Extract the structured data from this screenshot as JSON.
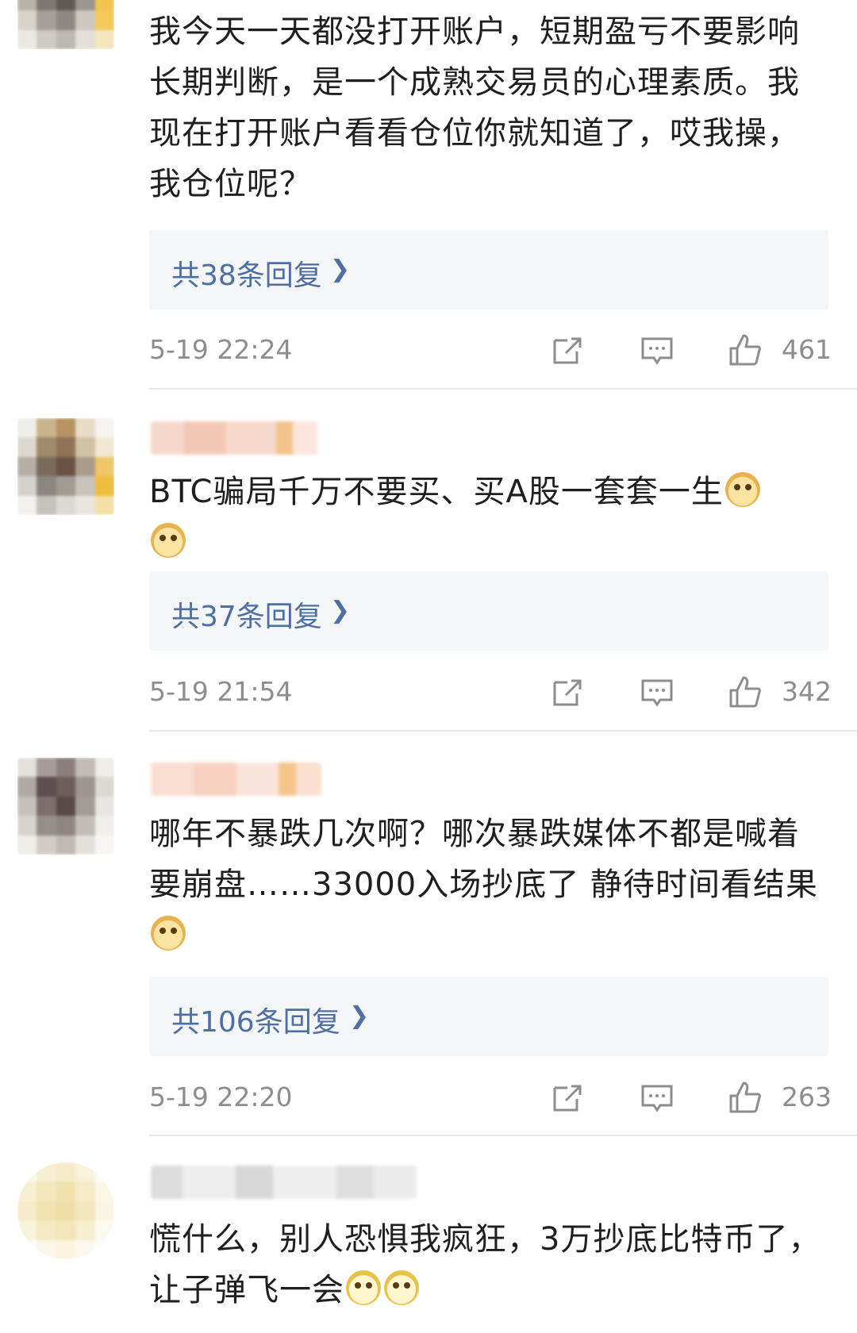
{
  "comments": [
    {
      "text": "我今天一天都没打开账户，短期盈亏不要影响长期判断，是一个成熟交易员的心理素质。我现在打开账户看看仓位你就知道了，哎我操，我仓位呢？",
      "reply_label": "共38条回复",
      "time": "5-19 22:24",
      "likes": "461"
    },
    {
      "text": "BTC骗局千万不要买、买A股一套套一生",
      "reply_label": "共37条回复",
      "time": "5-19 21:54",
      "likes": "342"
    },
    {
      "text": "哪年不暴跌几次啊？哪次暴跌媒体不都是喊着要崩盘……33000入场抄底了 静待时间看结果",
      "reply_label": "共106条回复",
      "time": "5-19 22:20",
      "likes": "263"
    },
    {
      "text": "慌什么，别人恐惧我疯狂，3万抄底比特币了，让子弹飞一会"
    }
  ],
  "icons": {
    "forward": "share-icon",
    "comment": "comment-icon",
    "like": "thumbs-up-icon",
    "emoji_doge": "doge-emoji-icon",
    "emoji_other": "smile-emoji-icon"
  },
  "colors": {
    "reply_link": "#4e6fa3",
    "meta_text": "#8d8d8d",
    "reply_bg": "#f5f6f8"
  }
}
